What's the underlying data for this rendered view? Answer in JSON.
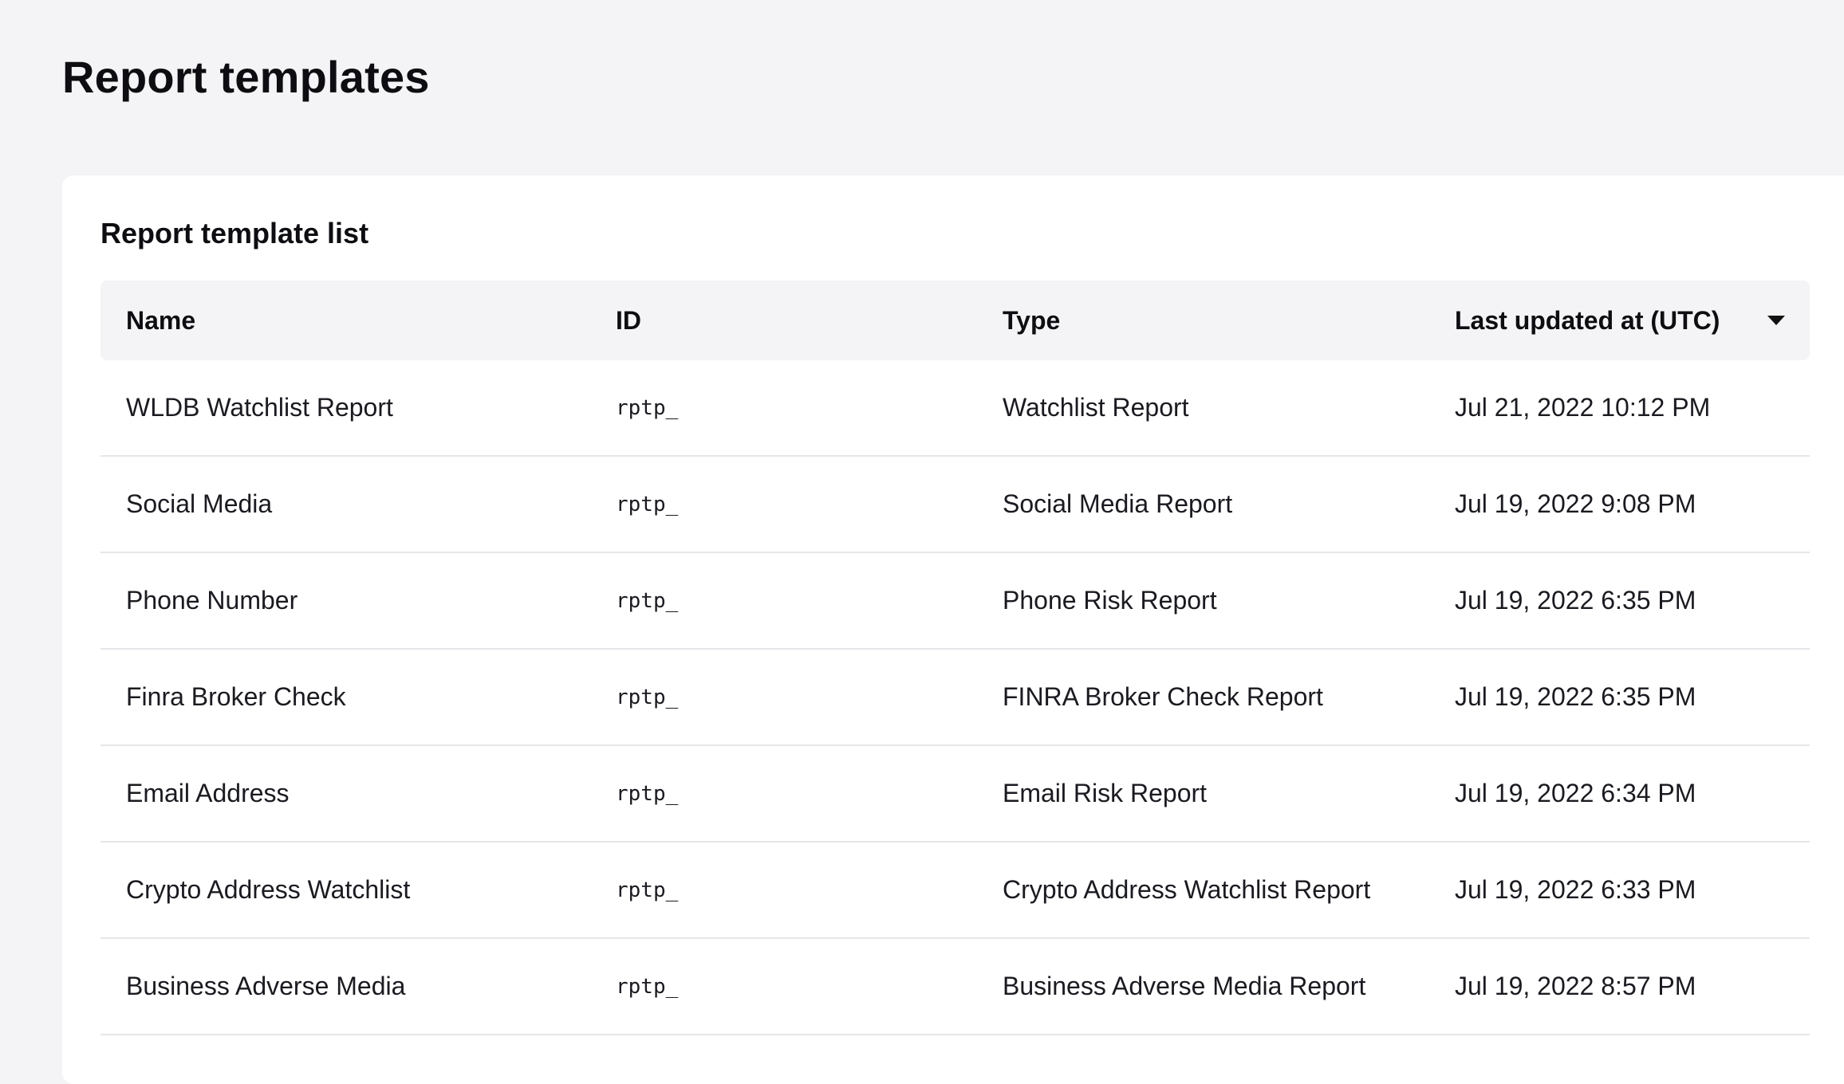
{
  "page": {
    "title": "Report templates"
  },
  "card": {
    "title": "Report template list"
  },
  "table": {
    "columns": {
      "name": "Name",
      "id": "ID",
      "type": "Type",
      "updated": "Last updated at (UTC)"
    },
    "sort_icon": "caret-down-icon",
    "rows": [
      {
        "name": "WLDB Watchlist Report",
        "id": "rptp_",
        "type": "Watchlist Report",
        "updated": "Jul 21, 2022 10:12 PM"
      },
      {
        "name": "Social Media",
        "id": "rptp_",
        "type": "Social Media Report",
        "updated": "Jul 19, 2022 9:08 PM"
      },
      {
        "name": "Phone Number",
        "id": "rptp_",
        "type": "Phone Risk Report",
        "updated": "Jul 19, 2022 6:35 PM"
      },
      {
        "name": "Finra Broker Check",
        "id": "rptp_",
        "type": "FINRA Broker Check Report",
        "updated": "Jul 19, 2022 6:35 PM"
      },
      {
        "name": "Email Address",
        "id": "rptp_",
        "type": "Email Risk Report",
        "updated": "Jul 19, 2022 6:34 PM"
      },
      {
        "name": "Crypto Address Watchlist",
        "id": "rptp_",
        "type": "Crypto Address Watchlist Report",
        "updated": "Jul 19, 2022 6:33 PM"
      },
      {
        "name": "Business Adverse Media",
        "id": "rptp_",
        "type": "Business Adverse Media Report",
        "updated": "Jul 19, 2022 8:57 PM"
      }
    ]
  }
}
